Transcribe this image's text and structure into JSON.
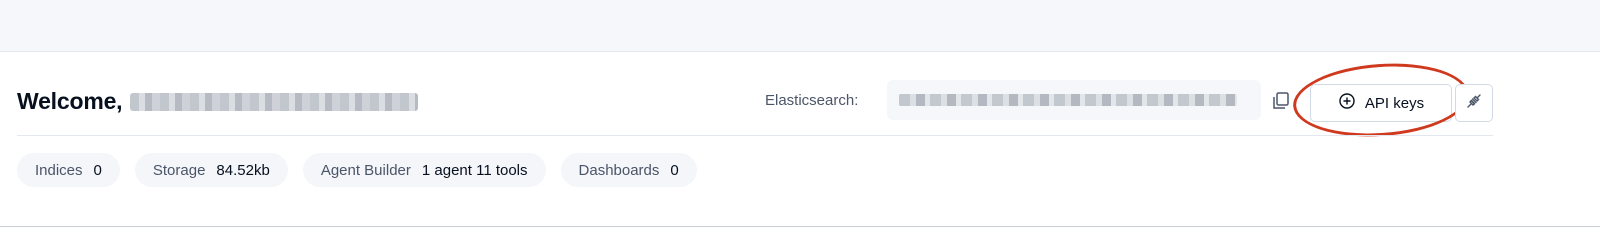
{
  "header": {
    "welcome": "Welcome,",
    "redacted_email_icon": "redacted-text"
  },
  "connection": {
    "label": "Elasticsearch:",
    "redacted_url_icon": "redacted-text",
    "copy_icon": "copy-icon",
    "api_keys_label": "API keys",
    "api_keys_icon": "plus-circle-icon",
    "connect_icon": "plug-icon"
  },
  "annotation": {
    "highlight_color": "#cf3a1f"
  },
  "stats": [
    {
      "label": "Indices",
      "value": "0"
    },
    {
      "label": "Storage",
      "value": "84.52kb"
    },
    {
      "label": "Agent Builder",
      "value": "1 agent 11 tools"
    },
    {
      "label": "Dashboards",
      "value": "0"
    }
  ]
}
